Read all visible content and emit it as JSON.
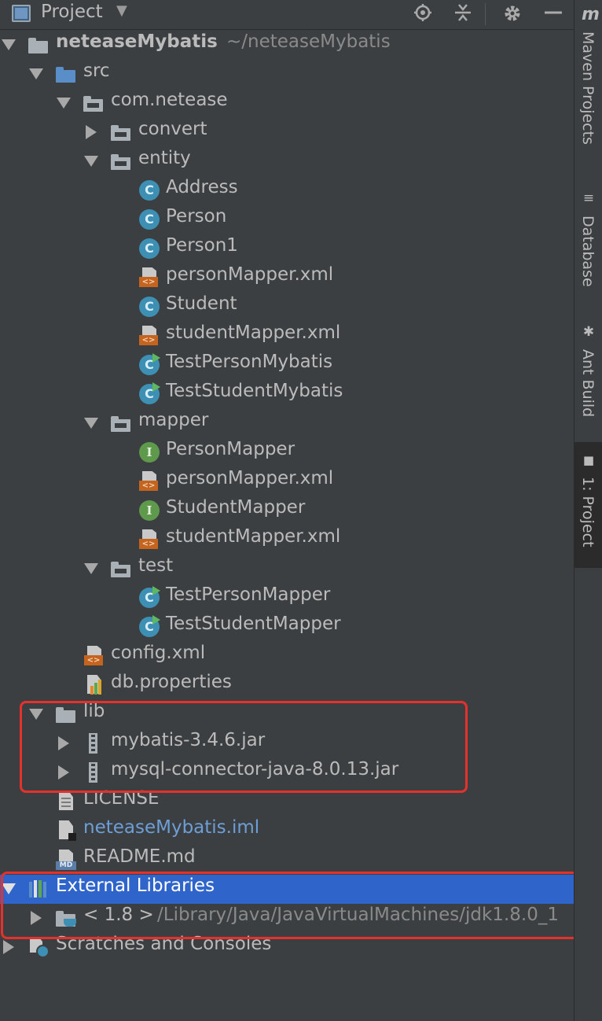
{
  "header": {
    "title": "Project",
    "caret": "▼"
  },
  "tree": [
    {
      "label": "neteaseMybatis",
      "sub": "~/neteaseMybatis",
      "icon": "module-folder-icon",
      "expanded": true,
      "bold": true
    },
    {
      "label": "src",
      "icon": "source-folder-icon",
      "expanded": true
    },
    {
      "label": "com.netease",
      "icon": "package-icon",
      "expanded": true
    },
    {
      "label": "convert",
      "icon": "package-icon",
      "expanded": false
    },
    {
      "label": "entity",
      "icon": "package-icon",
      "expanded": true
    },
    {
      "label": "Address",
      "icon": "class-icon"
    },
    {
      "label": "Person",
      "icon": "class-icon"
    },
    {
      "label": "Person1",
      "icon": "class-icon"
    },
    {
      "label": "personMapper.xml",
      "icon": "xml-file-icon"
    },
    {
      "label": "Student",
      "icon": "class-icon"
    },
    {
      "label": "studentMapper.xml",
      "icon": "xml-file-icon"
    },
    {
      "label": "TestPersonMybatis",
      "icon": "test-class-icon"
    },
    {
      "label": "TestStudentMybatis",
      "icon": "test-class-icon"
    },
    {
      "label": "mapper",
      "icon": "package-icon",
      "expanded": true
    },
    {
      "label": "PersonMapper",
      "icon": "interface-icon"
    },
    {
      "label": "personMapper.xml",
      "icon": "xml-file-icon"
    },
    {
      "label": "StudentMapper",
      "icon": "interface-icon"
    },
    {
      "label": "studentMapper.xml",
      "icon": "xml-file-icon"
    },
    {
      "label": "test",
      "icon": "package-icon",
      "expanded": true
    },
    {
      "label": "TestPersonMapper",
      "icon": "test-class-icon"
    },
    {
      "label": "TestStudentMapper",
      "icon": "test-class-icon"
    },
    {
      "label": "config.xml",
      "icon": "xml-file-icon"
    },
    {
      "label": "db.properties",
      "icon": "properties-file-icon"
    },
    {
      "label": "lib",
      "icon": "folder-icon",
      "expanded": true
    },
    {
      "label": "mybatis-3.4.6.jar",
      "icon": "jar-icon",
      "expanded": false
    },
    {
      "label": "mysql-connector-java-8.0.13.jar",
      "icon": "jar-icon",
      "expanded": false
    },
    {
      "label": "LICENSE",
      "icon": "text-file-icon"
    },
    {
      "label": "neteaseMybatis.iml",
      "icon": "iml-file-icon",
      "highlight": true
    },
    {
      "label": "README.md",
      "icon": "markdown-file-icon"
    },
    {
      "label": "External Libraries",
      "icon": "libraries-icon",
      "expanded": true,
      "selected": true
    },
    {
      "label": "< 1.8 >",
      "sub": "/Library/Java/JavaVirtualMachines/jdk1.8.0_1",
      "icon": "jdk-icon",
      "expanded": false
    },
    {
      "label": "Scratches and Consoles",
      "icon": "scratches-icon",
      "expanded": false
    }
  ],
  "side_tabs": [
    {
      "label": "Maven Projects",
      "icon": "maven-icon",
      "glyph": "m"
    },
    {
      "label": "Database",
      "icon": "database-icon",
      "glyph": "≡"
    },
    {
      "label": "Ant Build",
      "icon": "ant-icon",
      "glyph": "✱"
    },
    {
      "label": "1: Project",
      "icon": "project-folder-icon",
      "glyph": "■",
      "active": true
    }
  ],
  "colors": {
    "background": "#3c3f41",
    "selection": "#2f65ca",
    "annotation": "#e5312b",
    "module_link": "#6e9ed6"
  }
}
